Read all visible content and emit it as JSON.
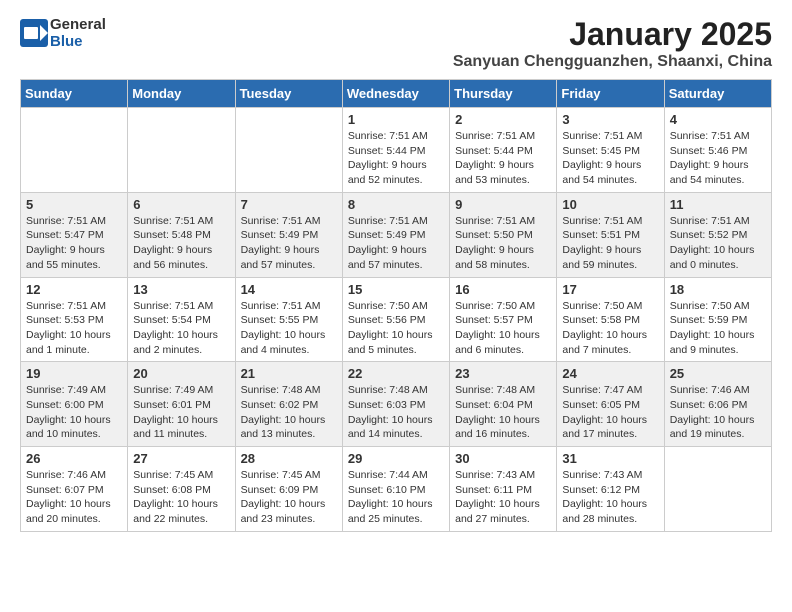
{
  "logo": {
    "general": "General",
    "blue": "Blue"
  },
  "title": "January 2025",
  "subtitle": "Sanyuan Chengguanzhen, Shaanxi, China",
  "weekdays": [
    "Sunday",
    "Monday",
    "Tuesday",
    "Wednesday",
    "Thursday",
    "Friday",
    "Saturday"
  ],
  "weeks": [
    [
      {
        "day": "",
        "info": ""
      },
      {
        "day": "",
        "info": ""
      },
      {
        "day": "",
        "info": ""
      },
      {
        "day": "1",
        "info": "Sunrise: 7:51 AM\nSunset: 5:44 PM\nDaylight: 9 hours and 52 minutes."
      },
      {
        "day": "2",
        "info": "Sunrise: 7:51 AM\nSunset: 5:44 PM\nDaylight: 9 hours and 53 minutes."
      },
      {
        "day": "3",
        "info": "Sunrise: 7:51 AM\nSunset: 5:45 PM\nDaylight: 9 hours and 54 minutes."
      },
      {
        "day": "4",
        "info": "Sunrise: 7:51 AM\nSunset: 5:46 PM\nDaylight: 9 hours and 54 minutes."
      }
    ],
    [
      {
        "day": "5",
        "info": "Sunrise: 7:51 AM\nSunset: 5:47 PM\nDaylight: 9 hours and 55 minutes."
      },
      {
        "day": "6",
        "info": "Sunrise: 7:51 AM\nSunset: 5:48 PM\nDaylight: 9 hours and 56 minutes."
      },
      {
        "day": "7",
        "info": "Sunrise: 7:51 AM\nSunset: 5:49 PM\nDaylight: 9 hours and 57 minutes."
      },
      {
        "day": "8",
        "info": "Sunrise: 7:51 AM\nSunset: 5:49 PM\nDaylight: 9 hours and 57 minutes."
      },
      {
        "day": "9",
        "info": "Sunrise: 7:51 AM\nSunset: 5:50 PM\nDaylight: 9 hours and 58 minutes."
      },
      {
        "day": "10",
        "info": "Sunrise: 7:51 AM\nSunset: 5:51 PM\nDaylight: 9 hours and 59 minutes."
      },
      {
        "day": "11",
        "info": "Sunrise: 7:51 AM\nSunset: 5:52 PM\nDaylight: 10 hours and 0 minutes."
      }
    ],
    [
      {
        "day": "12",
        "info": "Sunrise: 7:51 AM\nSunset: 5:53 PM\nDaylight: 10 hours and 1 minute."
      },
      {
        "day": "13",
        "info": "Sunrise: 7:51 AM\nSunset: 5:54 PM\nDaylight: 10 hours and 2 minutes."
      },
      {
        "day": "14",
        "info": "Sunrise: 7:51 AM\nSunset: 5:55 PM\nDaylight: 10 hours and 4 minutes."
      },
      {
        "day": "15",
        "info": "Sunrise: 7:50 AM\nSunset: 5:56 PM\nDaylight: 10 hours and 5 minutes."
      },
      {
        "day": "16",
        "info": "Sunrise: 7:50 AM\nSunset: 5:57 PM\nDaylight: 10 hours and 6 minutes."
      },
      {
        "day": "17",
        "info": "Sunrise: 7:50 AM\nSunset: 5:58 PM\nDaylight: 10 hours and 7 minutes."
      },
      {
        "day": "18",
        "info": "Sunrise: 7:50 AM\nSunset: 5:59 PM\nDaylight: 10 hours and 9 minutes."
      }
    ],
    [
      {
        "day": "19",
        "info": "Sunrise: 7:49 AM\nSunset: 6:00 PM\nDaylight: 10 hours and 10 minutes."
      },
      {
        "day": "20",
        "info": "Sunrise: 7:49 AM\nSunset: 6:01 PM\nDaylight: 10 hours and 11 minutes."
      },
      {
        "day": "21",
        "info": "Sunrise: 7:48 AM\nSunset: 6:02 PM\nDaylight: 10 hours and 13 minutes."
      },
      {
        "day": "22",
        "info": "Sunrise: 7:48 AM\nSunset: 6:03 PM\nDaylight: 10 hours and 14 minutes."
      },
      {
        "day": "23",
        "info": "Sunrise: 7:48 AM\nSunset: 6:04 PM\nDaylight: 10 hours and 16 minutes."
      },
      {
        "day": "24",
        "info": "Sunrise: 7:47 AM\nSunset: 6:05 PM\nDaylight: 10 hours and 17 minutes."
      },
      {
        "day": "25",
        "info": "Sunrise: 7:46 AM\nSunset: 6:06 PM\nDaylight: 10 hours and 19 minutes."
      }
    ],
    [
      {
        "day": "26",
        "info": "Sunrise: 7:46 AM\nSunset: 6:07 PM\nDaylight: 10 hours and 20 minutes."
      },
      {
        "day": "27",
        "info": "Sunrise: 7:45 AM\nSunset: 6:08 PM\nDaylight: 10 hours and 22 minutes."
      },
      {
        "day": "28",
        "info": "Sunrise: 7:45 AM\nSunset: 6:09 PM\nDaylight: 10 hours and 23 minutes."
      },
      {
        "day": "29",
        "info": "Sunrise: 7:44 AM\nSunset: 6:10 PM\nDaylight: 10 hours and 25 minutes."
      },
      {
        "day": "30",
        "info": "Sunrise: 7:43 AM\nSunset: 6:11 PM\nDaylight: 10 hours and 27 minutes."
      },
      {
        "day": "31",
        "info": "Sunrise: 7:43 AM\nSunset: 6:12 PM\nDaylight: 10 hours and 28 minutes."
      },
      {
        "day": "",
        "info": ""
      }
    ]
  ]
}
